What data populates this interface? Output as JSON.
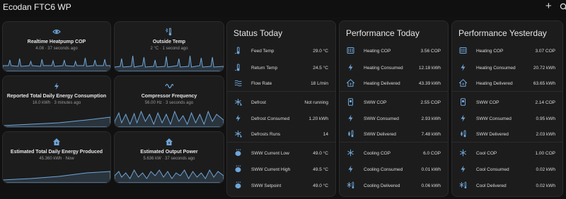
{
  "header": {
    "title": "Ecodan FTC6 WP"
  },
  "sensors": [
    {
      "name": "Realtime Heatpump COP",
      "sub": "4.08 · 37 seconds ago",
      "icon": "eye-icon"
    },
    {
      "name": "Outside Temp",
      "sub": "2 °C · 1 second ago",
      "icon": "sun-thermometer-icon"
    },
    {
      "name": "Reported Total Daily Energy Consumption",
      "sub": "16.0 kWh · 3 minutes ago",
      "icon": "lightning-icon"
    },
    {
      "name": "Compressor Frequency",
      "sub": "56.00 Hz · 3 seconds ago",
      "icon": "sine-wave-icon"
    },
    {
      "name": "Estimated Total Daily Energy Produced",
      "sub": "45.360 kWh · Now",
      "icon": "home-lightning-icon"
    },
    {
      "name": "Estimated Output Power",
      "sub": "5.636 kW · 37 seconds ago",
      "icon": "home-lightning-icon"
    }
  ],
  "status": {
    "title": "Status Today",
    "rows": [
      {
        "label": "Feed Temp",
        "value": "29.0 °C",
        "icon": "thermometer-water-icon"
      },
      {
        "label": "Return Temp",
        "value": "24.5 °C",
        "icon": "thermometer-water-icon"
      },
      {
        "label": "Flow Rate",
        "value": "18 L/min",
        "icon": "waves-icon"
      },
      {
        "label": "Defrost",
        "value": "Not running",
        "icon": "snowflake-melt-icon"
      },
      {
        "label": "Defrost Consumed",
        "value": "1.20 kWh",
        "icon": "lightning-icon"
      },
      {
        "label": "Defrosts Runs",
        "value": "14",
        "icon": "snowflake-melt-icon"
      },
      {
        "label": "SWW Current Low",
        "value": "49.0 °C",
        "icon": "water-boiler-icon"
      },
      {
        "label": "SWW Current High",
        "value": "49.5 °C",
        "icon": "water-boiler-icon"
      },
      {
        "label": "SWW Setpoint",
        "value": "49.0 °C",
        "icon": "water-boiler-icon"
      }
    ]
  },
  "perf_today": {
    "title": "Performance Today",
    "rows": [
      {
        "label": "Heating COP",
        "value": "3.56 COP",
        "icon": "radiator-icon"
      },
      {
        "label": "Heating Consumed",
        "value": "12.18 kWh",
        "icon": "lightning-icon"
      },
      {
        "label": "Heating Delivered",
        "value": "43.39 kWh",
        "icon": "home-lightning-icon"
      },
      {
        "label": "SWW COP",
        "value": "2.55 COP",
        "icon": "water-heater-icon"
      },
      {
        "label": "SWW Consumed",
        "value": "2.93 kWh",
        "icon": "lightning-icon"
      },
      {
        "label": "SWW Delivered",
        "value": "7.48 kWh",
        "icon": "water-thermometer-icon"
      },
      {
        "label": "Cooling COP",
        "value": "6.0 COP",
        "icon": "snowflake-icon"
      },
      {
        "label": "Cooling Consumed",
        "value": "0.01 kWh",
        "icon": "lightning-icon"
      },
      {
        "label": "Cooling Delivered",
        "value": "0.06 kWh",
        "icon": "snowflake-thermometer-icon"
      }
    ]
  },
  "perf_yesterday": {
    "title": "Performance Yesterday",
    "rows": [
      {
        "label": "Heating COP",
        "value": "3.07 COP",
        "icon": "radiator-icon"
      },
      {
        "label": "Heating Consumed",
        "value": "20.72 kWh",
        "icon": "lightning-icon"
      },
      {
        "label": "Heating Delivered",
        "value": "63.65 kWh",
        "icon": "home-lightning-icon"
      },
      {
        "label": "SWW COP",
        "value": "2.14 COP",
        "icon": "water-heater-icon"
      },
      {
        "label": "SWW Consumed",
        "value": "0.95 kWh",
        "icon": "lightning-icon"
      },
      {
        "label": "SWW Delivered",
        "value": "2.03 kWh",
        "icon": "water-thermometer-icon"
      },
      {
        "label": "Cool COP",
        "value": "1.00 COP",
        "icon": "snowflake-icon"
      },
      {
        "label": "Cool Consumed",
        "value": "0.02 kWh",
        "icon": "lightning-icon"
      },
      {
        "label": "Cool Delivered",
        "value": "0.02 kWh",
        "icon": "snowflake-thermometer-icon"
      }
    ]
  },
  "colors": {
    "accent": "#6fa6d9",
    "background": "#111111",
    "card": "#1c1c1c"
  }
}
